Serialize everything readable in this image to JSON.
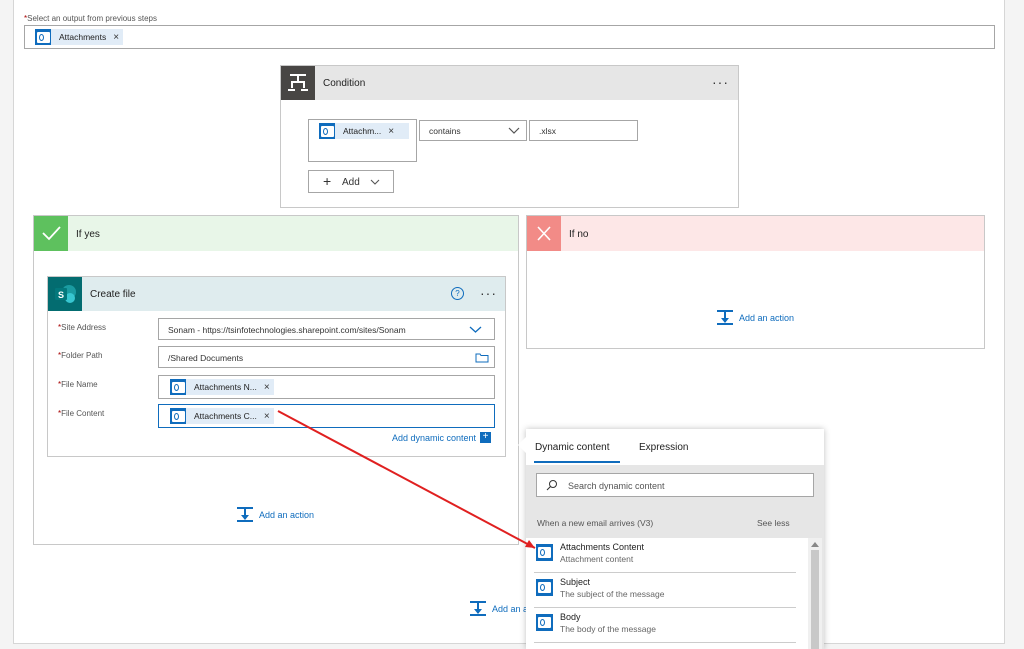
{
  "top": {
    "label_prefix": "*",
    "label": "Select an output from previous steps",
    "token": "Attachments",
    "remove": "×"
  },
  "condition": {
    "title": "Condition",
    "more": "···",
    "left_token": "Attachm...",
    "remove": "×",
    "operator": "contains",
    "value": ".xlsx",
    "add_label": "Add",
    "plus": "+"
  },
  "if_yes": {
    "title": "If yes",
    "add_action": "Add an action"
  },
  "if_no": {
    "title": "If no",
    "add_action": "Add an action"
  },
  "create_file": {
    "title": "Create file",
    "help": "?",
    "more": "···",
    "site_address_label": "Site Address",
    "site_address_value": "Sonam - https://tsinfotechnologies.sharepoint.com/sites/Sonam",
    "folder_path_label": "Folder Path",
    "folder_path_value": "/Shared Documents",
    "file_name_label": "File Name",
    "file_name_token": "Attachments N...",
    "file_content_label": "File Content",
    "file_content_token": "Attachments C...",
    "remove": "×",
    "required_mark": "*",
    "add_dynamic": "Add dynamic content"
  },
  "bottom": {
    "add_action": "Add an a"
  },
  "dynamic_panel": {
    "tab_dynamic": "Dynamic content",
    "tab_expression": "Expression",
    "search_placeholder": "Search dynamic content",
    "section_title": "When a new email arrives (V3)",
    "see_less": "See less",
    "items": [
      {
        "title": "Attachments Content",
        "subtitle": "Attachment content"
      },
      {
        "title": "Subject",
        "subtitle": "The subject of the message"
      },
      {
        "title": "Body",
        "subtitle": "The body of the message"
      }
    ]
  },
  "colors": {
    "accent": "#0f6cbd",
    "yes_header": "#e8f6e8",
    "yes_icon": "#5ec15e",
    "no_header": "#fde7e7",
    "no_icon": "#f28b87",
    "condition_icon": "#484644",
    "sharepoint": "#036c70",
    "arrow": "#e02020"
  }
}
